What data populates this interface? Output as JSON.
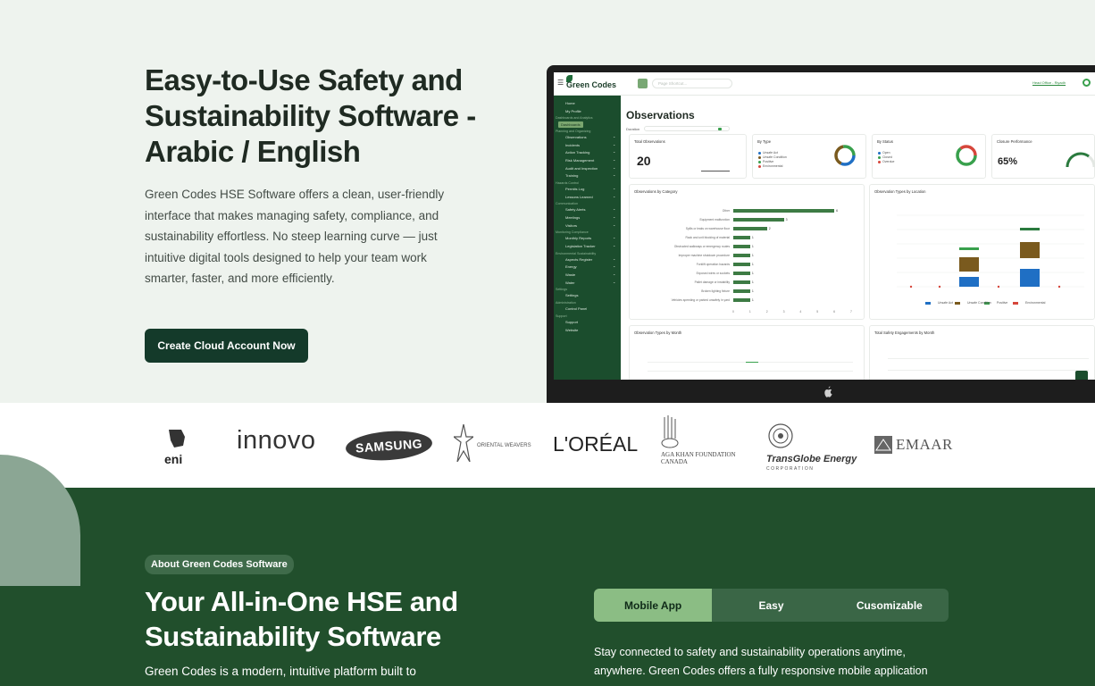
{
  "hero": {
    "title": "Easy-to-Use Safety and Sustainability Software - Arabic / English",
    "description": "Green Codes HSE Software offers a clean, user-friendly interface that makes managing safety, compliance, and sustainability effortless. No steep learning curve — just intuitive digital tools designed to help your team work smarter, faster, and more efficiently.",
    "cta_label": "Create Cloud Account Now"
  },
  "app": {
    "logo": "Green Codes",
    "search_placeholder": "Page Shortcut...",
    "user": "Head Office - Riyadh",
    "page_title": "Observations",
    "duration_label": "Duration",
    "sidebar": [
      {
        "label": "Home",
        "group": false
      },
      {
        "label": "My Profile",
        "group": false
      },
      {
        "label": "Dashboards and Analytics",
        "group": true
      },
      {
        "label": "Dashboards",
        "group": false,
        "active": true
      },
      {
        "label": "Planning and Organizing",
        "group": true
      },
      {
        "label": "Observations",
        "group": false
      },
      {
        "label": "Incidents",
        "group": false
      },
      {
        "label": "Action Tracking",
        "group": false
      },
      {
        "label": "Risk Management",
        "group": false
      },
      {
        "label": "Audit and Inspection",
        "group": false
      },
      {
        "label": "Training",
        "group": false
      },
      {
        "label": "Hazards Control",
        "group": true
      },
      {
        "label": "Permits Log",
        "group": false
      },
      {
        "label": "Lessons Learned",
        "group": false
      },
      {
        "label": "Communication",
        "group": true
      },
      {
        "label": "Safety Alerts",
        "group": false
      },
      {
        "label": "Meetings",
        "group": false
      },
      {
        "label": "Visitors",
        "group": false
      },
      {
        "label": "Monitoring Compliance",
        "group": true
      },
      {
        "label": "Monthly Reports",
        "group": false
      },
      {
        "label": "Legislation Tracker",
        "group": false
      },
      {
        "label": "Environmental Sustainability",
        "group": true
      },
      {
        "label": "Aspects Register",
        "group": false
      },
      {
        "label": "Energy",
        "group": false
      },
      {
        "label": "Waste",
        "group": false
      },
      {
        "label": "Water",
        "group": false
      },
      {
        "label": "Settings",
        "group": true
      },
      {
        "label": "Settings",
        "group": false
      },
      {
        "label": "Administration",
        "group": true
      },
      {
        "label": "Control Panel",
        "group": false
      },
      {
        "label": "Support",
        "group": true
      },
      {
        "label": "Support",
        "group": false
      },
      {
        "label": "Website",
        "group": false
      }
    ],
    "cards": {
      "total": {
        "title": "Total Observations",
        "value": "20"
      },
      "by_type": {
        "title": "By Type",
        "legend": [
          "Unsafe Act",
          "Unsafe Condition",
          "Positive",
          "Environmental"
        ]
      },
      "by_status": {
        "title": "By Status",
        "legend": [
          "Open",
          "Closed",
          "Overdue"
        ]
      },
      "closure": {
        "title": "Closure Performance",
        "value": "65%"
      },
      "by_category": "Observations by Category",
      "by_location": "Observation Types by Location",
      "by_month": "Observation Types by Month",
      "engagements": "Total Safety Engagements by Month"
    },
    "location_legend": [
      "Unsafe Act",
      "Unsafe Condition",
      "Positive",
      "Environmental"
    ],
    "colors": {
      "sidebar": "#1b4d2d",
      "accent": "#38a04c",
      "bar": "#3d7b44",
      "brown": "#7a5a1e",
      "blue": "#1f6fc4",
      "red": "#d6463b"
    }
  },
  "chart_data": {
    "type": "bar",
    "title": "Observations by Category",
    "categories": [
      "Other",
      "Equipment malfunction",
      "Spills or leaks on warehouse floor",
      "Rack and unit blocking of material",
      "Obstructed walkways or emergency routes",
      "Improper machine shutdown procedure",
      "Forklift operation hazards",
      "Exposed wires or sockets",
      "Pallet damage or instability",
      "Broken lighting fixture",
      "Vehicles speeding or parked unsafely in yard"
    ],
    "values": [
      6,
      3,
      2,
      1,
      1,
      1,
      1,
      1,
      1,
      1,
      1
    ],
    "xlim": [
      0,
      7
    ],
    "xticks": [
      "0",
      "1",
      "2",
      "3",
      "4",
      "5",
      "6",
      "7"
    ]
  },
  "logos": [
    "eni",
    "innovo",
    "SAMSUNG",
    "ORIENTAL WEAVERS",
    "L'ORÉAL",
    "AGA KHAN FOUNDATION CANADA",
    "TransGlobe Energy",
    "EMAAR"
  ],
  "about": {
    "badge": "About Green Codes Software",
    "title": "Your All-in-One HSE and Sustainability Software",
    "description": "Green Codes is a modern, intuitive platform built to",
    "tabs": [
      "Mobile App",
      "Easy",
      "Cusomizable"
    ],
    "tab_text": "Stay connected to safety and sustainability operations anytime, anywhere. Green Codes offers a fully responsive mobile application"
  }
}
